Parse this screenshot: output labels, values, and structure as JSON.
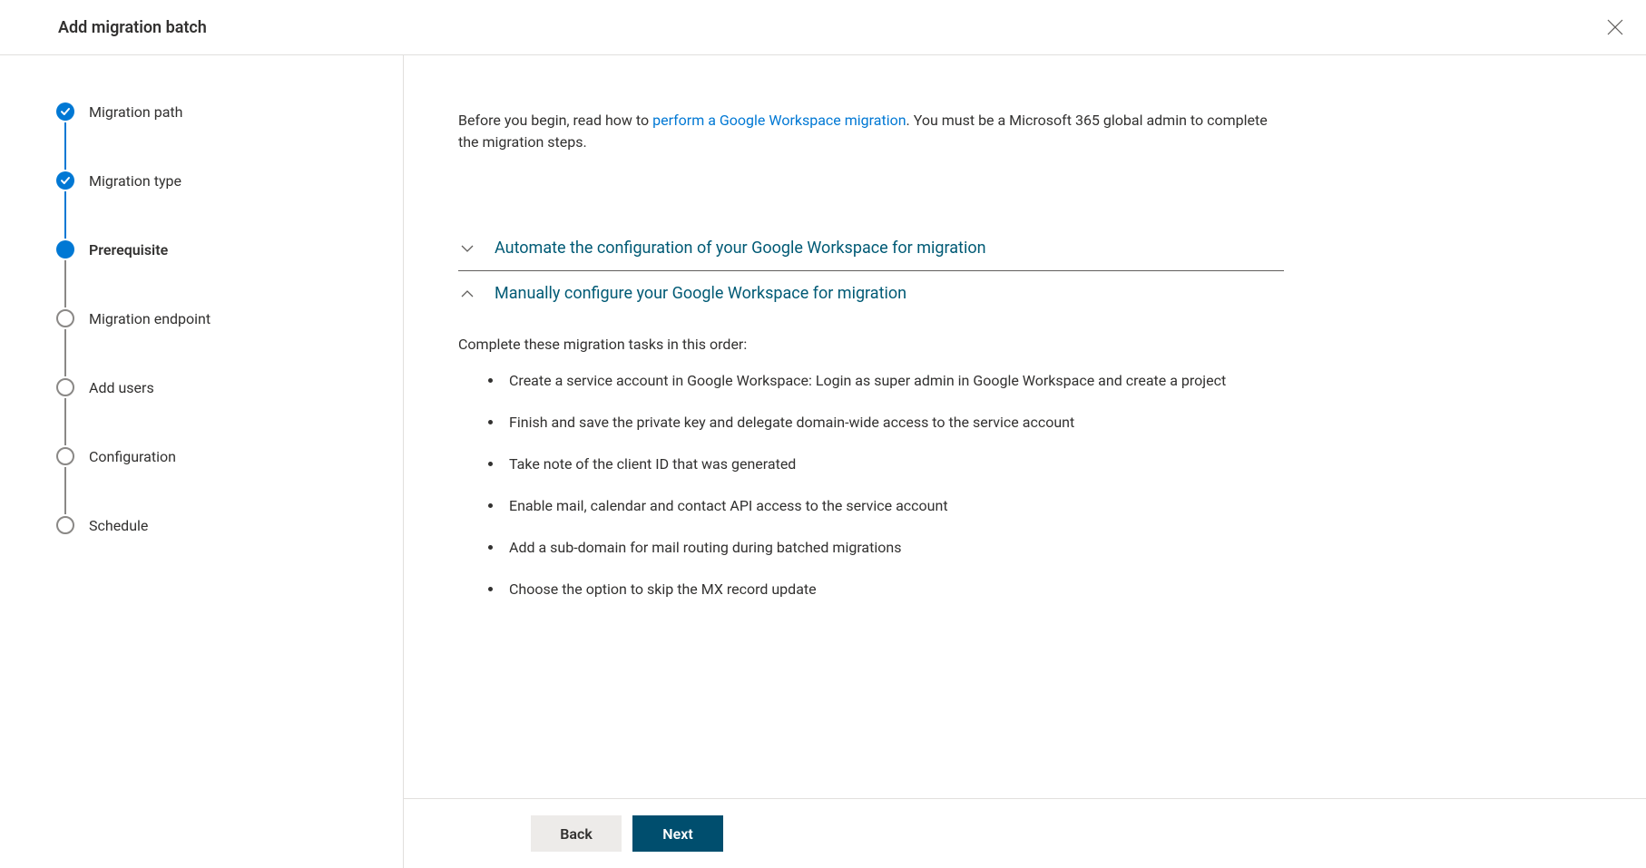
{
  "header": {
    "title": "Add migration batch"
  },
  "steps": [
    {
      "label": "Migration path",
      "state": "completed"
    },
    {
      "label": "Migration type",
      "state": "completed"
    },
    {
      "label": "Prerequisite",
      "state": "current"
    },
    {
      "label": "Migration endpoint",
      "state": "upcoming"
    },
    {
      "label": "Add users",
      "state": "upcoming"
    },
    {
      "label": "Configuration",
      "state": "upcoming"
    },
    {
      "label": "Schedule",
      "state": "upcoming"
    }
  ],
  "intro": {
    "before": "Before you begin, read how to ",
    "link": "perform a Google Workspace migration",
    "after": ". You must be a Microsoft 365 global admin to complete the migration steps."
  },
  "accordion": {
    "automate": {
      "title": "Automate the configuration of your Google Workspace for migration"
    },
    "manual": {
      "title": "Manually configure your Google Workspace for migration",
      "intro": "Complete these migration tasks in this order:",
      "tasks": [
        "Create a service account in Google Workspace: Login as super admin in Google Workspace and create a project",
        "Finish and save the private key and delegate domain-wide access to the service account",
        "Take note of the client ID that was generated",
        "Enable mail, calendar and contact API access to the service account",
        "Add a sub-domain for mail routing during batched migrations",
        "Choose the option to skip the MX record update"
      ]
    }
  },
  "footer": {
    "back": "Back",
    "next": "Next"
  }
}
